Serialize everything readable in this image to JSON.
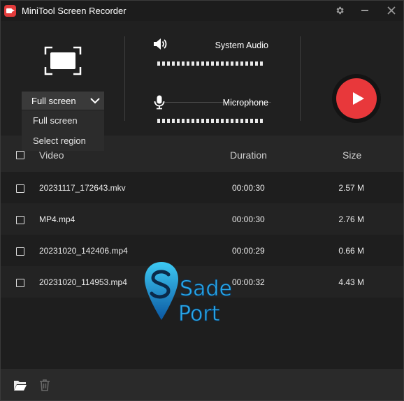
{
  "titlebar": {
    "title": "MiniTool Screen Recorder",
    "icons": [
      "settings-icon",
      "minimize-icon",
      "close-icon"
    ]
  },
  "capture": {
    "mode_selected": "Full screen",
    "mode_options": [
      "Full screen",
      "Select region"
    ]
  },
  "audio": {
    "system_label": "System Audio",
    "mic_label": "Microphone"
  },
  "table": {
    "headers": {
      "video": "Video",
      "duration": "Duration",
      "size": "Size"
    },
    "rows": [
      {
        "name": "20231117_172643.mkv",
        "duration": "00:00:30",
        "size": "2.57 M"
      },
      {
        "name": "MP4.mp4",
        "duration": "00:00:30",
        "size": "2.76 M"
      },
      {
        "name": "20231020_142406.mp4",
        "duration": "00:00:29",
        "size": "0.66 M"
      },
      {
        "name": "20231020_114953.mp4",
        "duration": "00:00:32",
        "size": "4.43 M"
      }
    ]
  },
  "watermark": {
    "line1": "Sade",
    "line2": "Port"
  },
  "colors": {
    "accent": "#e8383b",
    "background": "#1e1e1e",
    "header": "#272727",
    "footer": "#2a2a2a"
  }
}
